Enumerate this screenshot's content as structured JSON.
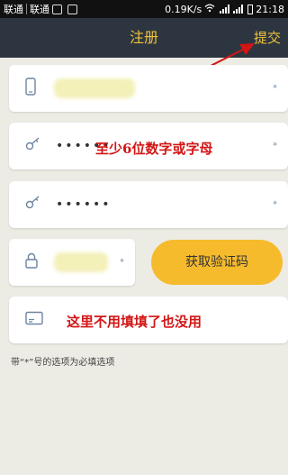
{
  "status_bar": {
    "carrier1": "联通",
    "carrier2": "联通",
    "speed": "0.19K/s",
    "time": "21:18"
  },
  "header": {
    "title": "注册",
    "submit_label": "提交"
  },
  "form": {
    "phone": {
      "icon": "phone-icon",
      "required_mark": "*"
    },
    "password": {
      "icon": "key-icon",
      "value": "••••••",
      "required_mark": "*"
    },
    "password_confirm": {
      "icon": "key-icon",
      "value": "••••••",
      "required_mark": "*"
    },
    "verify_code": {
      "icon": "lock-icon",
      "required_mark": "*"
    },
    "get_code_label": "获取验证码",
    "optional_field": {
      "icon": "card-icon"
    }
  },
  "annotations": {
    "password_note": "至少6位数字或字母",
    "optional_note": "这里不用填填了也没用",
    "arrow_color": "#d21515"
  },
  "hint": "带“*”号的选项为必填选项",
  "colors": {
    "accent": "#f0c23c",
    "header_bg": "#2d3640",
    "button_bg": "#f6bb2c",
    "page_bg": "#ecebe4"
  }
}
